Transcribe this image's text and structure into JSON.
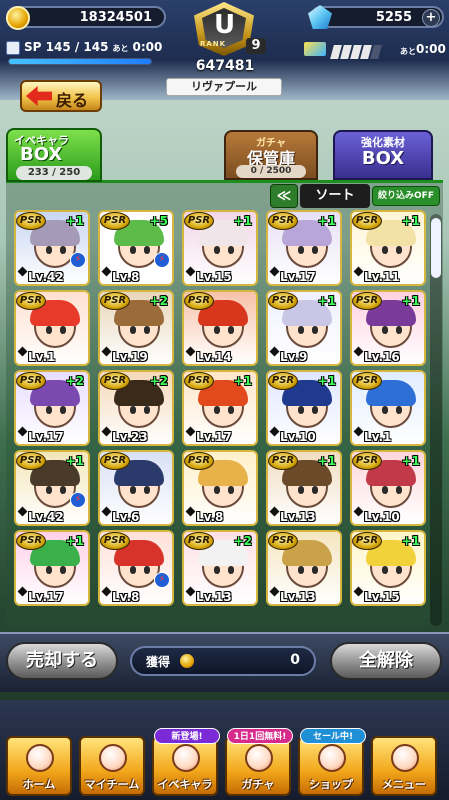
{
  "header": {
    "coins": "18324501",
    "gems": "5255",
    "gem_plus": "+",
    "sp_label": "SP",
    "sp_value": "145 / 145",
    "sp_ato": "あと",
    "sp_time": "0:00",
    "sp_fill": 1.0,
    "rank_label": "RANK",
    "rank_letter": "U",
    "rank_level": "9",
    "rank_points": "647481",
    "team_name": "リヴァプール",
    "right_ato": "あと",
    "right_time": "0:00",
    "energy_segments_filled": 4,
    "energy_segments_total": 5
  },
  "back_button": {
    "label": "戻る"
  },
  "tabs": {
    "ibekyara": {
      "line1": "イベキャラ",
      "line2": "BOX",
      "count": "233 / 250"
    },
    "gacha": {
      "line1": "ガチャ",
      "line2": "保管庫",
      "count": "0 / 2500"
    },
    "kyoka": {
      "line1": "強化素材",
      "line2": "BOX"
    }
  },
  "sort_bar": {
    "chevron": "≪",
    "sort_label": "ソート",
    "filter_label": "絞り込みOFF"
  },
  "cards": [
    {
      "rarity": "PSR",
      "plus": "+1",
      "level": "Lv.42",
      "bolt": true,
      "hair": "#a59bb8",
      "bg": "#c9d6f2"
    },
    {
      "rarity": "PSR",
      "plus": "+5",
      "level": "Lv.8",
      "bolt": true,
      "hair": "#5dbb4a",
      "bg": "#ffffff"
    },
    {
      "rarity": "PSR",
      "plus": "+1",
      "level": "Lv.15",
      "bolt": false,
      "hair": "#f0e6ea",
      "bg": "#f2d6e8"
    },
    {
      "rarity": "PSR",
      "plus": "+1",
      "level": "Lv.17",
      "bolt": false,
      "hair": "#b8a6d9",
      "bg": "#e6e0f5"
    },
    {
      "rarity": "PSR",
      "plus": "+1",
      "level": "Lv.11",
      "bolt": false,
      "hair": "#f2e2a6",
      "bg": "#fff6d6"
    },
    {
      "rarity": "PSR",
      "plus": "",
      "level": "Lv.1",
      "bolt": false,
      "hair": "#e83a2a",
      "bg": "#ffe0d0"
    },
    {
      "rarity": "PSR",
      "plus": "+2",
      "level": "Lv.19",
      "bolt": false,
      "hair": "#9c6b3a",
      "bg": "#e8d6b8"
    },
    {
      "rarity": "PSR",
      "plus": "",
      "level": "Lv.14",
      "bolt": false,
      "hair": "#d9361e",
      "bg": "#f7c2a8"
    },
    {
      "rarity": "PSR",
      "plus": "+1",
      "level": "Lv.9",
      "bolt": false,
      "hair": "#c9c6e6",
      "bg": "#f0f0ff"
    },
    {
      "rarity": "PSR",
      "plus": "+1",
      "level": "Lv.16",
      "bolt": false,
      "hair": "#7a3a9a",
      "bg": "#ffd0e0"
    },
    {
      "rarity": "PSR",
      "plus": "+2",
      "level": "Lv.17",
      "bolt": false,
      "hair": "#7a4ab0",
      "bg": "#e8dcff"
    },
    {
      "rarity": "PSR",
      "plus": "+2",
      "level": "Lv.23",
      "bolt": false,
      "hair": "#3a2a1a",
      "bg": "#f5d8b8"
    },
    {
      "rarity": "PSR",
      "plus": "+1",
      "level": "Lv.17",
      "bolt": false,
      "hair": "#e24a1e",
      "bg": "#ffe6c8"
    },
    {
      "rarity": "PSR",
      "plus": "+1",
      "level": "Lv.10",
      "bolt": false,
      "hair": "#1f3a8f",
      "bg": "#dfe6ff"
    },
    {
      "rarity": "PSR",
      "plus": "",
      "level": "Lv.1",
      "bolt": false,
      "hair": "#2d6fd6",
      "bg": "#e0ecff"
    },
    {
      "rarity": "PSR",
      "plus": "+1",
      "level": "Lv.42",
      "bolt": true,
      "hair": "#4a3a2a",
      "bg": "#f2e6b8"
    },
    {
      "rarity": "PSR",
      "plus": "",
      "level": "Lv.6",
      "bolt": false,
      "hair": "#2a3a6a",
      "bg": "#d8e0f5"
    },
    {
      "rarity": "PSR",
      "plus": "",
      "level": "Lv.8",
      "bolt": false,
      "hair": "#e8b24a",
      "bg": "#fff0c8"
    },
    {
      "rarity": "PSR",
      "plus": "+1",
      "level": "Lv.13",
      "bolt": false,
      "hair": "#6b4a2a",
      "bg": "#f0dcc0"
    },
    {
      "rarity": "PSR",
      "plus": "+1",
      "level": "Lv.10",
      "bolt": false,
      "hair": "#c23a4a",
      "bg": "#ffd6dc"
    },
    {
      "rarity": "PSR",
      "plus": "+1",
      "level": "Lv.17",
      "bolt": false,
      "hair": "#3ab04a",
      "bg": "#ffd0e8"
    },
    {
      "rarity": "PSR",
      "plus": "",
      "level": "Lv.8",
      "bolt": true,
      "hair": "#d8332a",
      "bg": "#ffe0d8"
    },
    {
      "rarity": "PSR",
      "plus": "+2",
      "level": "Lv.13",
      "bolt": false,
      "hair": "#f2f2f2",
      "bg": "#ffe0e6"
    },
    {
      "rarity": "PSR",
      "plus": "",
      "level": "Lv.13",
      "bolt": false,
      "hair": "#c9a24a",
      "bg": "#f5e6c0"
    },
    {
      "rarity": "PSR",
      "plus": "+1",
      "level": "Lv.15",
      "bolt": false,
      "hair": "#f2d23a",
      "bg": "#fff6c8"
    }
  ],
  "action_bar": {
    "sell_label": "売却する",
    "gain_label": "獲得",
    "gain_value": "0",
    "clear_label": "全解除"
  },
  "bottom_nav": [
    {
      "label": "ホーム",
      "badge": ""
    },
    {
      "label": "マイチーム",
      "badge": ""
    },
    {
      "label": "イベキャラ",
      "badge": "新登場!"
    },
    {
      "label": "ガチャ",
      "badge": "1日1回無料!"
    },
    {
      "label": "ショップ",
      "badge": "セール中!"
    },
    {
      "label": "メニュー",
      "badge": ""
    }
  ]
}
